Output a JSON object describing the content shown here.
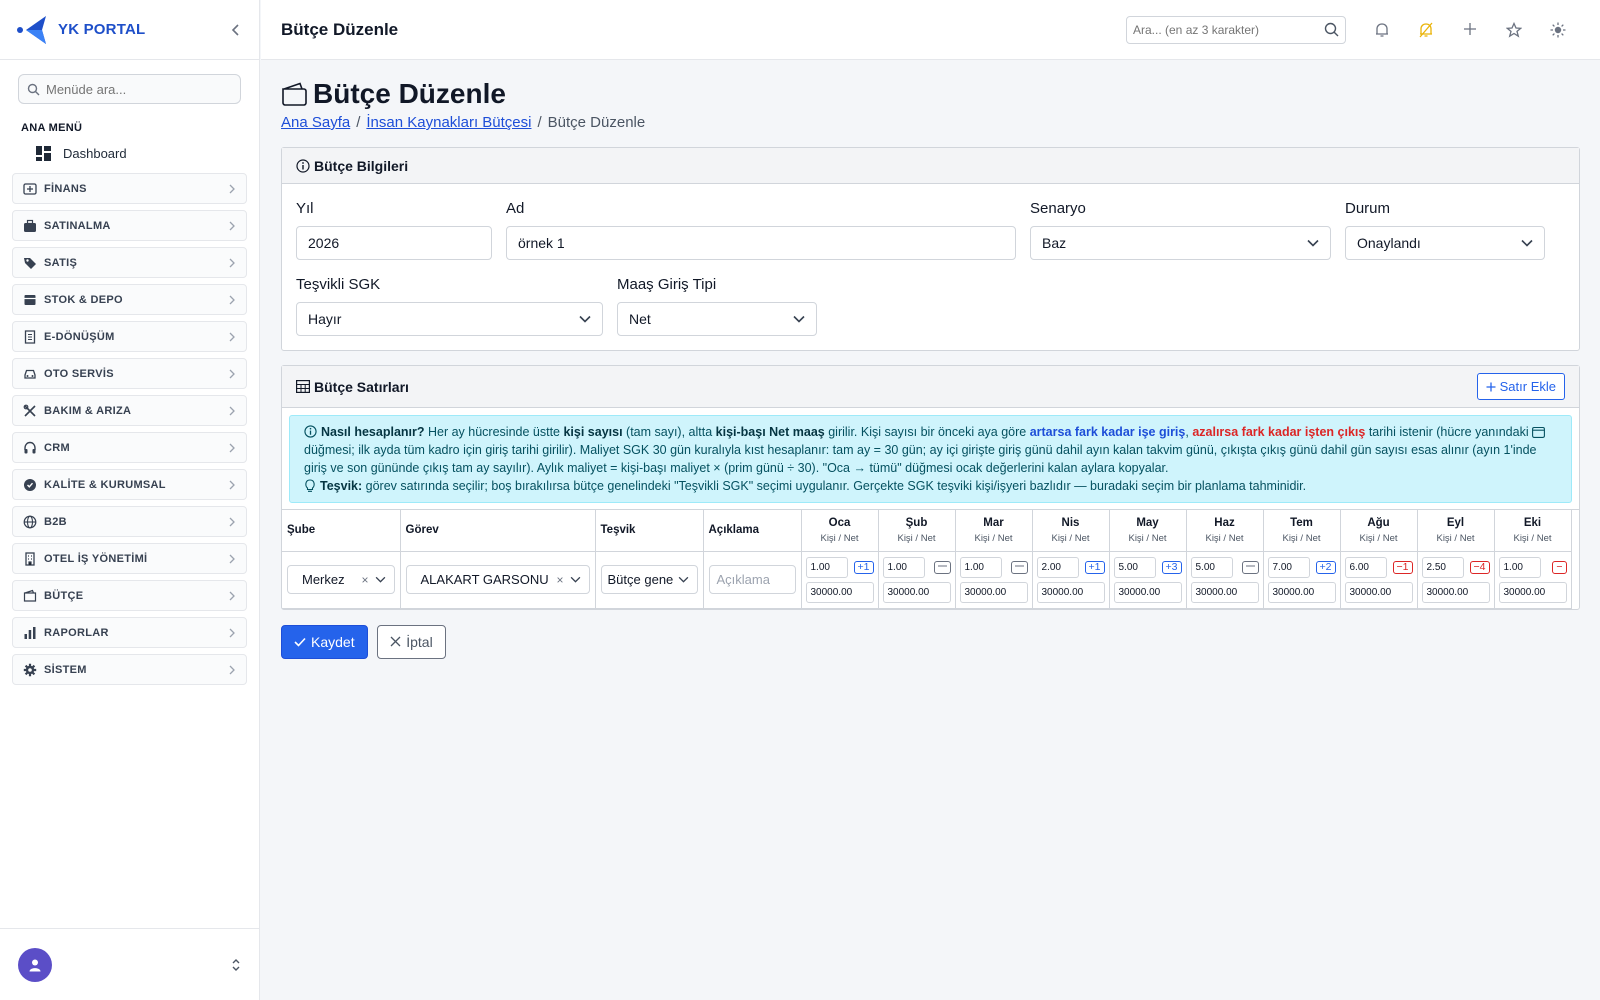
{
  "brand": {
    "name": "YK PORTAL"
  },
  "sidebar": {
    "search_placeholder": "Menüde ara...",
    "section_label": "ANA MENÜ",
    "dashboard_label": "Dashboard",
    "items": [
      {
        "label": "FİNANS",
        "icon": "finance-icon"
      },
      {
        "label": "SATINALMA",
        "icon": "briefcase-icon"
      },
      {
        "label": "SATIŞ",
        "icon": "tag-icon"
      },
      {
        "label": "STOK & DEPO",
        "icon": "box-icon"
      },
      {
        "label": "E-DÖNÜŞÜM",
        "icon": "receipt-icon"
      },
      {
        "label": "OTO SERVİS",
        "icon": "car-icon"
      },
      {
        "label": "BAKIM & ARIZA",
        "icon": "tools-icon"
      },
      {
        "label": "CRM",
        "icon": "headset-icon"
      },
      {
        "label": "KALİTE & KURUMSAL",
        "icon": "patch-check-icon"
      },
      {
        "label": "B2B",
        "icon": "globe-icon"
      },
      {
        "label": "OTEL İŞ YÖNETİMİ",
        "icon": "building-icon"
      },
      {
        "label": "BÜTÇE",
        "icon": "wallet-icon"
      },
      {
        "label": "RAPORLAR",
        "icon": "bar-chart-icon"
      },
      {
        "label": "SİSTEM",
        "icon": "gear-icon"
      }
    ]
  },
  "topbar": {
    "title": "Bütçe Düzenle",
    "search_placeholder": "Ara... (en az 3 karakter)"
  },
  "page": {
    "title": "Bütçe Düzenle",
    "breadcrumb": {
      "home": "Ana Sayfa",
      "parent": "İnsan Kaynakları Bütçesi",
      "current": "Bütçe Düzenle",
      "separator": "/"
    }
  },
  "info_card": {
    "title": "Bütçe Bilgileri",
    "fields": {
      "year": {
        "label": "Yıl",
        "value": "2026"
      },
      "name": {
        "label": "Ad",
        "value": "örnek 1"
      },
      "scenario": {
        "label": "Senaryo",
        "value": "Baz"
      },
      "status": {
        "label": "Durum",
        "value": "Onaylandı"
      },
      "sgk": {
        "label": "Teşvikli SGK",
        "value": "Hayır"
      },
      "salary_type": {
        "label": "Maaş Giriş Tipi",
        "value": "Net"
      }
    }
  },
  "lines_card": {
    "title": "Bütçe Satırları",
    "add_button": "Satır Ekle",
    "help": {
      "q": "Nasıl hesaplanır?",
      "t1": " Her ay hücresinde üstte ",
      "b1": "kişi sayısı",
      "t2": " (tam sayı), altta ",
      "b2": "kişi-başı Net maaş",
      "t3": " girilir. Kişi sayısı bir önceki aya göre ",
      "blue": "artarsa fark kadar işe giriş",
      "comma": ", ",
      "red": "azalırsa fark kadar işten çıkış",
      "t4": " tarihi istenir (hücre yanındaki ",
      "t5": " düğmesi; ilk ayda tüm kadro için giriş tarihi girilir). Maliyet SGK 30 gün kuralıyla kıst hesaplanır: tam ay = 30 gün; ay içi girişte giriş günü dahil ayın kalan takvim günü, çıkışta çıkış günü dahil gün sayısı esas alınır (ayın 1'inde giriş ve son gününde çıkış tam ay sayılır). Aylık maliyet = kişi-başı maliyet × (prim günü ÷ 30). \"Oca → tümü\" düğmesi ocak değerlerini kalan aylara kopyalar.",
      "tesvik_label": "Teşvik:",
      "tesvik_text": " görev satırında seçilir; boş bırakılırsa bütçe genelindeki \"Teşvikli SGK\" seçimi uygulanır. Gerçekte SGK teşviki kişi/işyeri bazlıdır — buradaki seçim bir planlama tahminidir."
    },
    "headers": {
      "branch": "Şube",
      "role": "Görev",
      "incentive": "Teşvik",
      "desc": "Açıklama",
      "month_sub": "Kişi / Net"
    },
    "months": [
      {
        "name": "Oca",
        "count": "1.00",
        "salary": "30000.00",
        "delta": "+1",
        "kind": "pos"
      },
      {
        "name": "Şub",
        "count": "1.00",
        "salary": "30000.00",
        "delta": "",
        "kind": "cal"
      },
      {
        "name": "Mar",
        "count": "1.00",
        "salary": "30000.00",
        "delta": "",
        "kind": "cal"
      },
      {
        "name": "Nis",
        "count": "2.00",
        "salary": "30000.00",
        "delta": "+1",
        "kind": "pos"
      },
      {
        "name": "May",
        "count": "5.00",
        "salary": "30000.00",
        "delta": "+3",
        "kind": "pos"
      },
      {
        "name": "Haz",
        "count": "5.00",
        "salary": "30000.00",
        "delta": "",
        "kind": "cal"
      },
      {
        "name": "Tem",
        "count": "7.00",
        "salary": "30000.00",
        "delta": "+2",
        "kind": "pos"
      },
      {
        "name": "Ağu",
        "count": "6.00",
        "salary": "30000.00",
        "delta": "−1",
        "kind": "neg"
      },
      {
        "name": "Eyl",
        "count": "2.50",
        "salary": "30000.00",
        "delta": "−4",
        "kind": "neg"
      },
      {
        "name": "Eki",
        "count": "1.00",
        "salary": "30000.00",
        "delta": "−",
        "kind": "neg"
      }
    ],
    "row": {
      "branch": "Merkez",
      "role": "ALAKART GARSONU",
      "incentive": "Bütçe genel",
      "desc_placeholder": "Açıklama",
      "clear": "×"
    }
  },
  "actions": {
    "save": "Kaydet",
    "cancel": "İptal"
  },
  "colors": {
    "primary": "#2563eb",
    "brand": "#1e4fc9",
    "info_bg": "#cff4fc",
    "danger": "#dc2626"
  }
}
